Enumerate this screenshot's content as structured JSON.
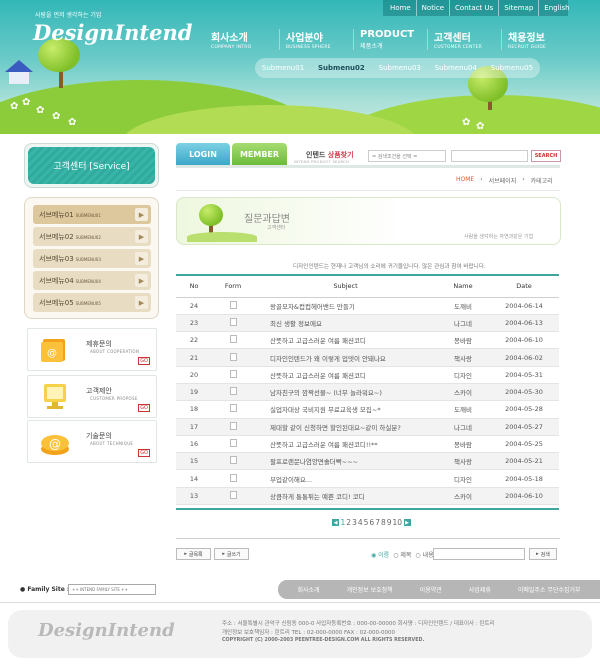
{
  "header": {
    "tagline": "사람을 먼저 생각하는 기업",
    "logo": "DesignIntend",
    "topnav": [
      "Home",
      "Notice",
      "Contact Us",
      "Sitemap",
      "English"
    ],
    "mainnav": [
      {
        "ko": "회사소개",
        "en": "COMPANY INTRO"
      },
      {
        "ko": "사업분야",
        "en": "BUSINESS SPHERE"
      },
      {
        "ko": "PRODUCT",
        "en": "제품소개"
      },
      {
        "ko": "고객센터",
        "en": "CUSTOMER CENTER"
      },
      {
        "ko": "채용정보",
        "en": "RECRUIT GUIDE"
      }
    ],
    "submenu": [
      "Submenu01",
      "Submenu02",
      "Submenu03",
      "Submenu04",
      "Submenu05"
    ],
    "submenu_active": "Submenu02"
  },
  "sidebar": {
    "service_title": "고객센터 [Service]",
    "items": [
      {
        "ko": "서브메뉴01",
        "en": "SUBMENU01"
      },
      {
        "ko": "서브메뉴02",
        "en": "SUBMENU02"
      },
      {
        "ko": "서브메뉴03",
        "en": "SUBMENU03"
      },
      {
        "ko": "서브메뉴04",
        "en": "SUBMENU04"
      },
      {
        "ko": "서브메뉴05",
        "en": "SUBMENU05"
      }
    ],
    "cards": [
      {
        "title": "제휴문의",
        "sub": "ABOUT COOPERATION",
        "go": "GO"
      },
      {
        "title": "고객제안",
        "sub": "CUSTOMER PROPOSE",
        "go": "GO"
      },
      {
        "title": "기술문의",
        "sub": "ABOUT TECHNIQUE",
        "go": "GO"
      }
    ]
  },
  "tabs": {
    "login": "LOGIN",
    "member": "MEMBER"
  },
  "product_search": {
    "title_a": "인텐드 ",
    "title_b": "상품찾기",
    "subtitle": "INTEND PRODUCT SEARCH",
    "select": "= 검색조건을 선택 =",
    "button": "SEARCH"
  },
  "breadcrumb": [
    "HOME",
    "서브페이지",
    "카테고리"
  ],
  "banner": {
    "title": "질문과답변",
    "subtitle": "고객센터",
    "right": "사람을 생각하는 자연과같은 기업"
  },
  "intro": "디자인인텐드는 현재나 고객님의 소리에 귀기울입니다. 많은 관심과 참여 바랍니다.",
  "board": {
    "columns": [
      "No",
      "Form",
      "Subject",
      "Name",
      "Date"
    ],
    "rows": [
      {
        "no": "24",
        "subject": "왕골모자&컵컵헤어밴드 만들기",
        "name": "도깨비",
        "date": "2004-06-14"
      },
      {
        "no": "23",
        "subject": "최신 생활 정보에요",
        "name": "나그네",
        "date": "2004-06-13"
      },
      {
        "no": "22",
        "subject": "산뜻하고 고급스러운 여름 패션코디",
        "name": "봉바람",
        "date": "2004-06-10"
      },
      {
        "no": "21",
        "subject": "디자인인텐드가 왜 이렇게 업뎃이 안돼나요",
        "name": "책사랑",
        "date": "2004-06-02"
      },
      {
        "no": "20",
        "subject": "산뜻하고 고급스러운 여름 패션코디",
        "name": "디자인",
        "date": "2004-05-31"
      },
      {
        "no": "19",
        "subject": "남자친구의 깜짝선물~ (너무 놀라워요~)",
        "name": "스카이",
        "date": "2004-05-30"
      },
      {
        "no": "18",
        "subject": "실업자대상 국비지원 무료교육생 모집~*",
        "name": "도깨비",
        "date": "2004-05-28"
      },
      {
        "no": "17",
        "subject": "제대할 같이 신청하면 할인된대요~같이 하실분?",
        "name": "나그네",
        "date": "2004-05-27"
      },
      {
        "no": "16",
        "subject": "산뜻하고 고급스러운 여름 패션코디!!**",
        "name": "봉바람",
        "date": "2004-05-25"
      },
      {
        "no": "15",
        "subject": "팔프로랜문나염양면솔더빡~~~",
        "name": "책사랑",
        "date": "2004-05-21"
      },
      {
        "no": "14",
        "subject": "부업같이해요...",
        "name": "디자인",
        "date": "2004-05-18"
      },
      {
        "no": "13",
        "subject": "상큼하게 통통튀는 예쁜 코디! 코디",
        "name": "스카이",
        "date": "2004-06-10"
      }
    ]
  },
  "pager": {
    "pages": [
      "1",
      "2",
      "3",
      "4",
      "5",
      "6",
      "7",
      "8",
      "9",
      "10"
    ],
    "current": "1"
  },
  "buttons": {
    "list": "글목록",
    "write": "글쓰기",
    "search": "검색"
  },
  "search_opts": [
    "이름",
    "제목",
    "내용"
  ],
  "footer": {
    "family_label": "Family Site :",
    "family_select": "++ INTEND FAMILY SITE ++",
    "nav": [
      "회사소개",
      "개인정보 보호정책",
      "이용약관",
      "사업제휴",
      "이메일주소 무단수집거부"
    ],
    "logo": "DesignIntend",
    "address": "주소 : 서울특별시 관악구 신림동 000-0    사업자등록번호 : 000-00-00000 회사명 : 디자인인텐드 / 대표이사 : 린트리",
    "privacy": "개인정보 보호책임자 : 린트리    TEL : 02-000-0000   FAX : 02-000-0000",
    "copyright": "COPYRIGHT (C) 2000-2003 PEENTREE-DESIGN.COM  ALL RIGHTS RESERVED."
  }
}
